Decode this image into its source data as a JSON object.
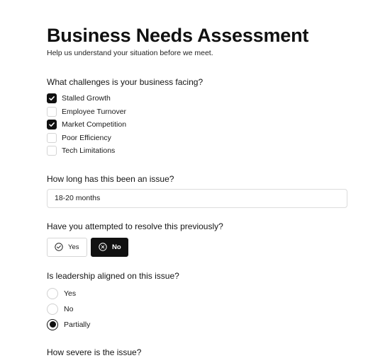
{
  "header": {
    "title": "Business Needs Assessment",
    "subtitle": "Help us understand your situation before we meet."
  },
  "challenges": {
    "question": "What challenges is your business facing?",
    "options": [
      {
        "label": "Stalled Growth",
        "checked": true
      },
      {
        "label": "Employee Turnover",
        "checked": false
      },
      {
        "label": "Market Competition",
        "checked": true
      },
      {
        "label": "Poor Efficiency",
        "checked": false
      },
      {
        "label": "Tech Limitations",
        "checked": false
      }
    ]
  },
  "duration": {
    "question": "How long has this been an issue?",
    "value": "18-20 months"
  },
  "attempted": {
    "question": "Have you attempted to resolve this previously?",
    "yes_label": "Yes",
    "no_label": "No",
    "selected": "No"
  },
  "leadership": {
    "question": "Is leadership aligned on this issue?",
    "options": [
      {
        "label": "Yes",
        "selected": false
      },
      {
        "label": "No",
        "selected": false
      },
      {
        "label": "Partially",
        "selected": true
      }
    ]
  },
  "severity": {
    "question": "How severe is the issue?"
  },
  "colors": {
    "accent": "#111111",
    "border": "#d4d4d4",
    "background": "#ffffff"
  },
  "icons": {
    "check": "check-icon",
    "yes": "circle-check-icon",
    "no": "circle-x-icon"
  }
}
